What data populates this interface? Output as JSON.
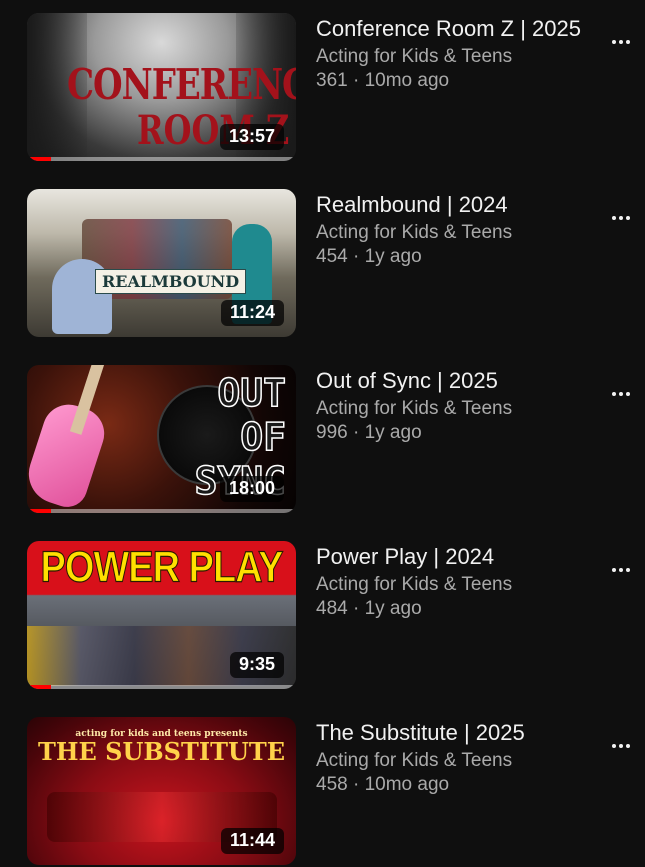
{
  "videos": [
    {
      "title": "Conference Room Z | 2025",
      "channel": "Acting for Kids & Teens",
      "stats": "361 · 10mo ago",
      "duration": "13:57",
      "progress": 0.09,
      "thumb_text": [
        "CONFERENCE",
        "ROOM Z"
      ]
    },
    {
      "title": "Realmbound | 2024",
      "channel": "Acting for Kids & Teens",
      "stats": "454 · 1y ago",
      "duration": "11:24",
      "progress": 0,
      "thumb_text": [
        "REALMBOUND"
      ]
    },
    {
      "title": "Out of Sync | 2025",
      "channel": "Acting for Kids & Teens",
      "stats": "996 · 1y ago",
      "duration": "18:00",
      "progress": 0.09,
      "thumb_text": [
        "OUT",
        "OF",
        "SYNC"
      ]
    },
    {
      "title": "Power Play | 2024",
      "channel": "Acting for Kids & Teens",
      "stats": "484 · 1y ago",
      "duration": "9:35",
      "progress": 0.09,
      "thumb_text": [
        "POWER PLAY"
      ]
    },
    {
      "title": "The Substitute | 2025",
      "channel": "Acting for Kids & Teens",
      "stats": "458 · 10mo ago",
      "duration": "11:44",
      "progress": 0,
      "thumb_text": [
        "acting for kids and teens presents",
        "THE SUBSTITUTE"
      ]
    }
  ],
  "colors": {
    "background": "#0f0f0f",
    "progress": "#ff0000",
    "secondary_text": "#aaaaaa"
  },
  "icons": {
    "menu": "more-vert-icon"
  }
}
